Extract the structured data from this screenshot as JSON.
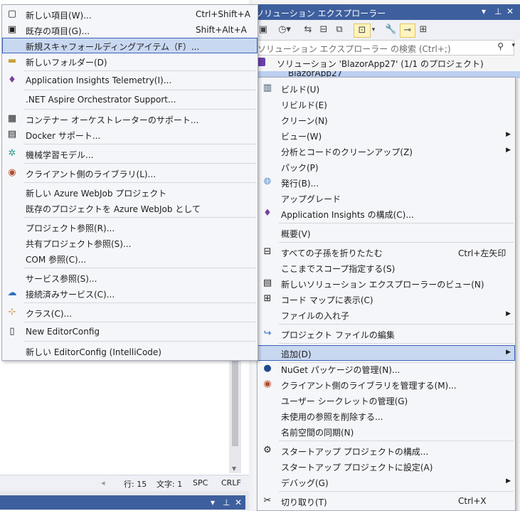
{
  "status_bar": {
    "line": "行: 15",
    "char": "文字: 1",
    "spc": "SPC",
    "crlf": "CRLF"
  },
  "bottom_panel": {
    "dropdown": "▾",
    "pin": "ᅰ",
    "close": "✕"
  },
  "solution_explorer": {
    "title": "ソリューション エクスプローラー",
    "title_dropdown": "▾",
    "title_pin": "ᅰ",
    "title_close": "✕",
    "search_placeholder": "ソリューション エクスプローラー の検索 (Ctrl+;)",
    "solution_label": "ソリューション 'BlazorApp27' (1/1 のプロジェクト)",
    "project_label": "BlazorApp27"
  },
  "context_menu": {
    "items": [
      {
        "label": "ビルド(U)",
        "icon": "build-icon"
      },
      {
        "label": "リビルド(E)"
      },
      {
        "label": "クリーン(N)"
      },
      {
        "label": "ビュー(W)",
        "submenu": true
      },
      {
        "label": "分析とコードのクリーンアップ(Z)",
        "submenu": true
      },
      {
        "label": "パック(P)"
      },
      {
        "label": "発行(B)...",
        "icon": "globe-icon"
      },
      {
        "label": "アップグレード"
      },
      {
        "label": "Application Insights の構成(C)...",
        "icon": "insights-icon"
      },
      {
        "label": "概要(V)"
      },
      {
        "label": "すべての子孫を折りたたむ",
        "shortcut": "Ctrl+左矢印",
        "icon": "collapse-icon"
      },
      {
        "label": "ここまでスコープ指定する(S)"
      },
      {
        "label": "新しいソリューション エクスプローラーのビュー(N)",
        "icon": "new-view-icon"
      },
      {
        "label": "コード マップに表示(C)",
        "icon": "code-map-icon"
      },
      {
        "label": "ファイルの入れ子",
        "submenu": true
      },
      {
        "label": "プロジェクト ファイルの編集",
        "icon": "edit-file-icon"
      },
      {
        "label": "追加(D)",
        "submenu": true
      },
      {
        "label": "NuGet パッケージの管理(N)...",
        "icon": "nuget-icon"
      },
      {
        "label": "クライアント側のライブラリを管理する(M)...",
        "icon": "library-icon"
      },
      {
        "label": "ユーザー シークレットの管理(G)"
      },
      {
        "label": "未使用の参照を削除する..."
      },
      {
        "label": "名前空間の同期(N)"
      },
      {
        "label": "スタートアップ プロジェクトの構成...",
        "icon": "gear-icon"
      },
      {
        "label": "スタートアップ プロジェクトに設定(A)"
      },
      {
        "label": "デバッグ(G)",
        "submenu": true
      },
      {
        "label": "切り取り(T)",
        "shortcut": "Ctrl+X",
        "icon": "cut-icon"
      }
    ]
  },
  "add_submenu": {
    "items": [
      {
        "label": "新しい項目(W)...",
        "shortcut": "Ctrl+Shift+A",
        "icon": "new-item-icon"
      },
      {
        "label": "既存の項目(G)...",
        "shortcut": "Shift+Alt+A",
        "icon": "existing-item-icon"
      },
      {
        "label": "新規スキャフォールディングアイテム（F）..."
      },
      {
        "label": "新しいフォルダー(D)",
        "icon": "new-folder-icon"
      },
      {
        "label": "Application Insights Telemetry(I)...",
        "icon": "insights-icon"
      },
      {
        "label": ".NET Aspire Orchestrator Support..."
      },
      {
        "label": "コンテナー オーケストレーターのサポート...",
        "icon": "container-icon"
      },
      {
        "label": "Docker サポート...",
        "icon": "docker-icon"
      },
      {
        "label": "機械学習モデル...",
        "icon": "ml-icon"
      },
      {
        "label": "クライアント側のライブラリ(L)...",
        "icon": "library-icon"
      },
      {
        "label": "新しい Azure WebJob プロジェクト"
      },
      {
        "label": "既存のプロジェクトを Azure WebJob として"
      },
      {
        "label": "プロジェクト参照(R)..."
      },
      {
        "label": "共有プロジェクト参照(S)..."
      },
      {
        "label": "COM 参照(C)..."
      },
      {
        "label": "サービス参照(S)..."
      },
      {
        "label": "接続済みサービス(C)...",
        "icon": "connected-service-icon"
      },
      {
        "label": "クラス(C)...",
        "icon": "class-icon"
      },
      {
        "label": "New EditorConfig",
        "icon": "file-icon"
      },
      {
        "label": "新しい EditorConfig (IntelliCode)"
      }
    ]
  }
}
